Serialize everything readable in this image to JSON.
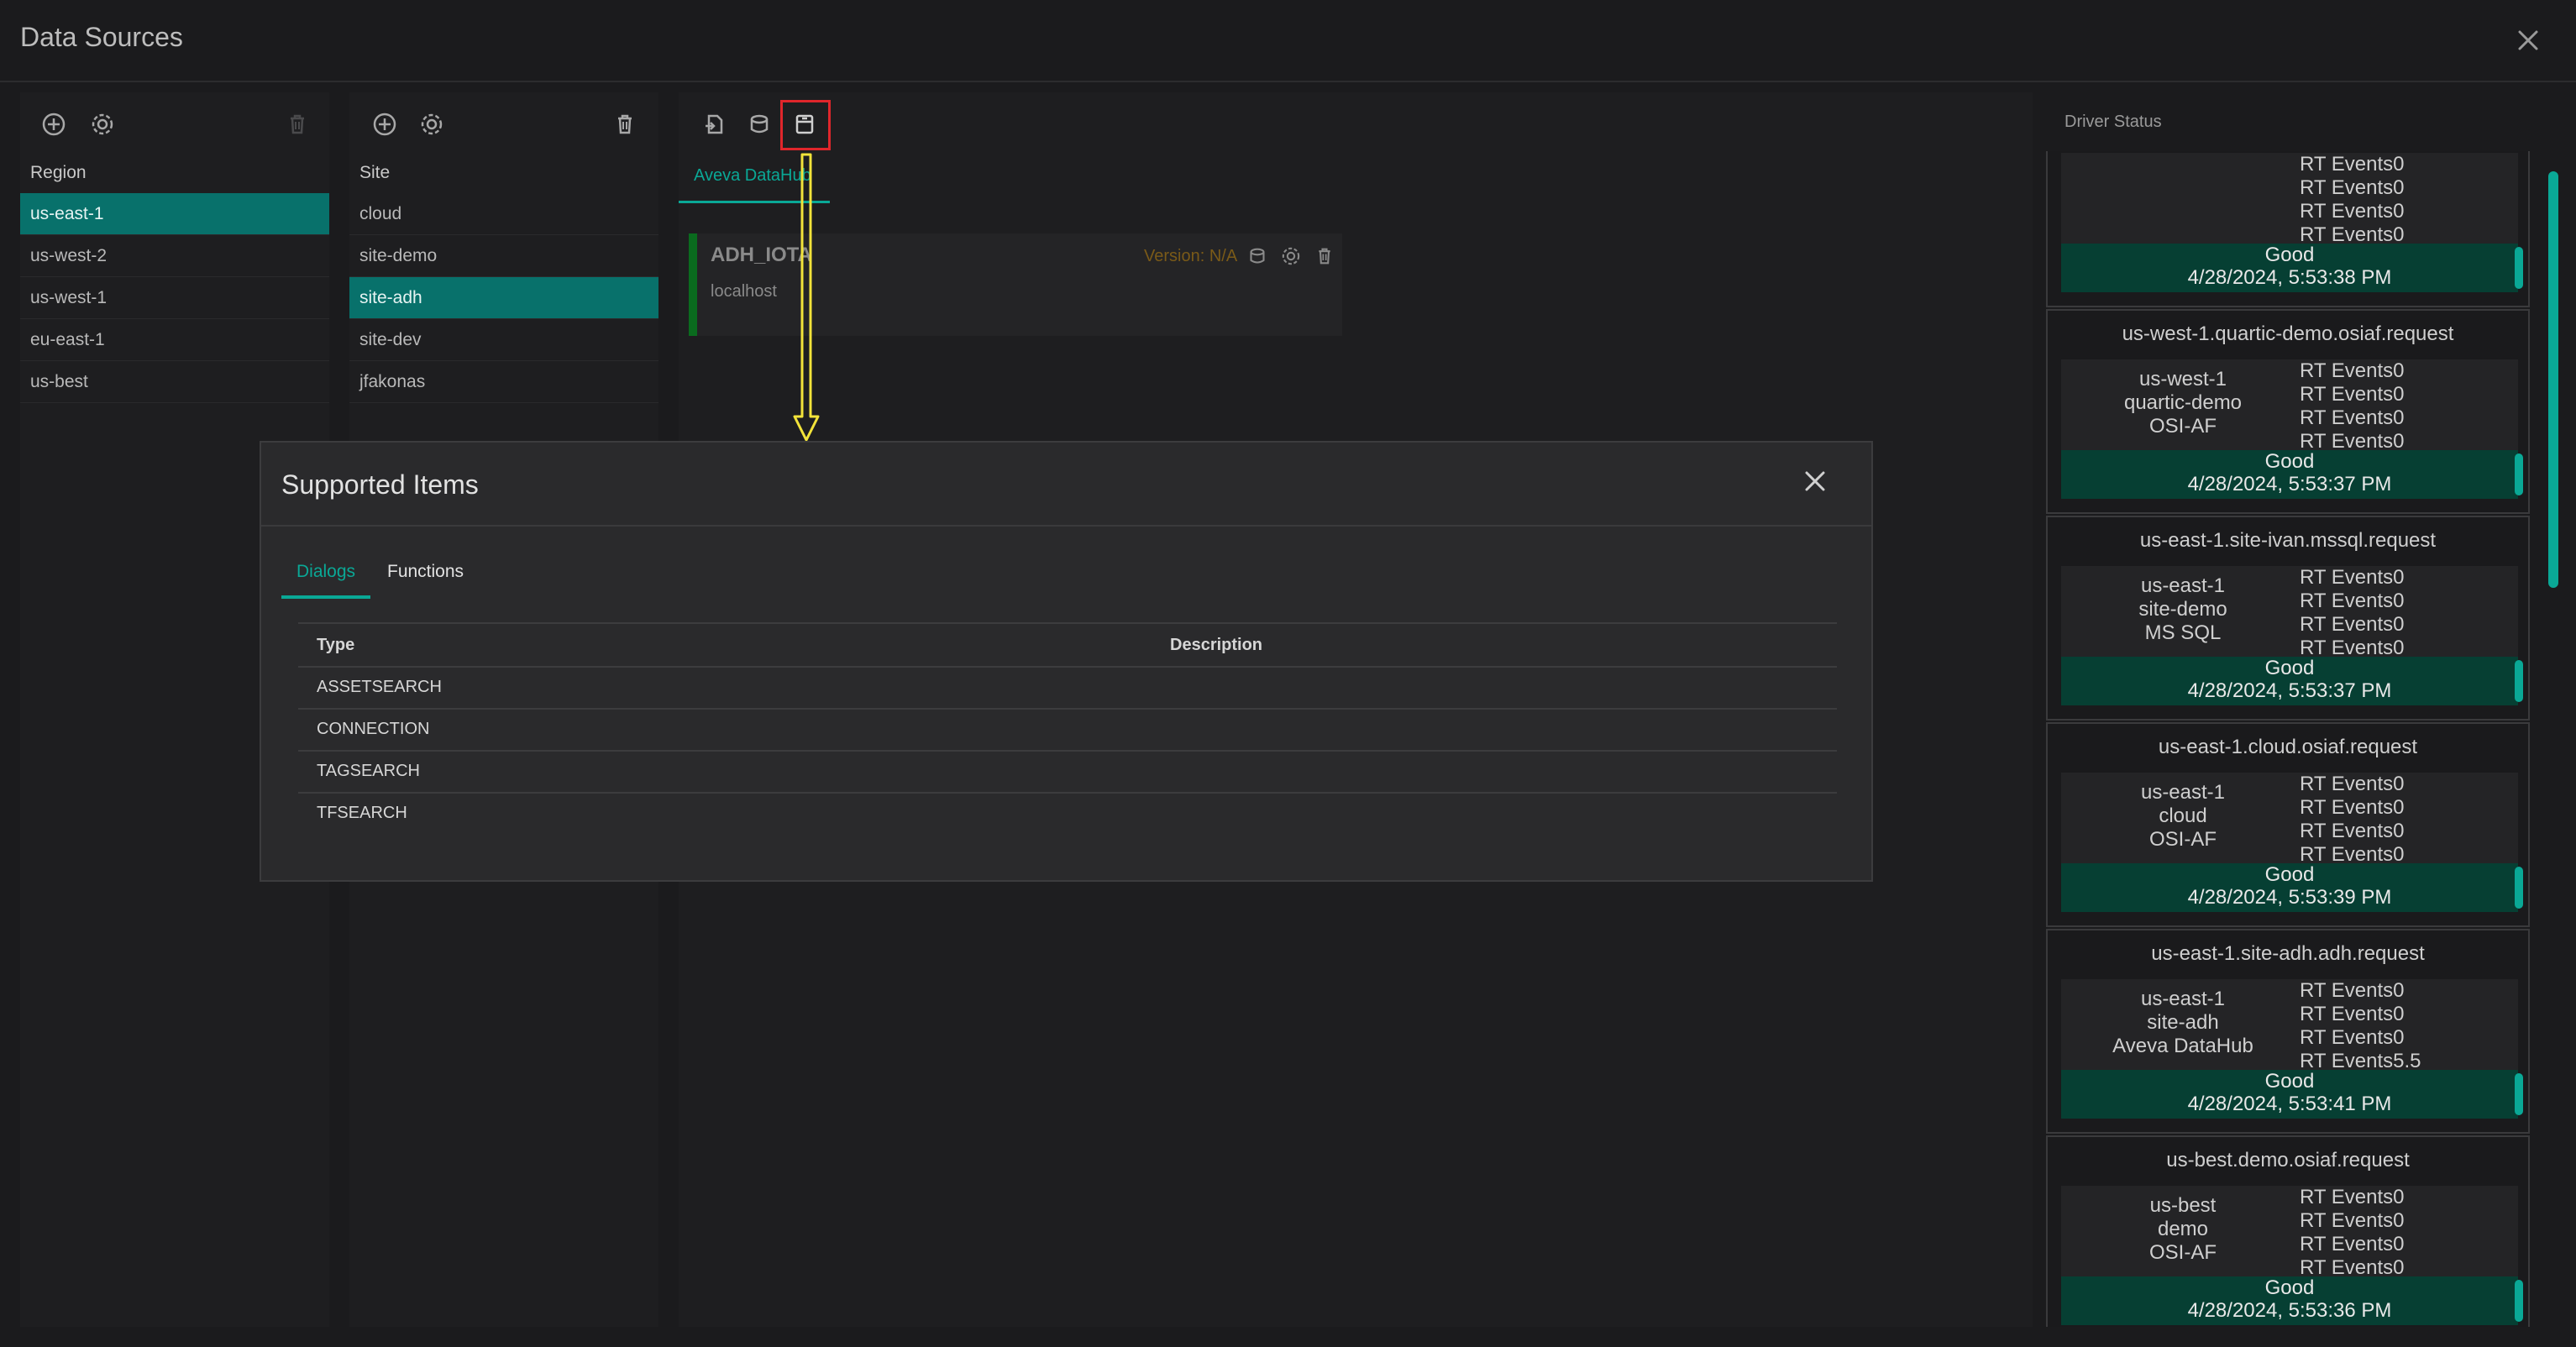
{
  "app": {
    "title": "Data Sources"
  },
  "region_panel": {
    "header": "Region",
    "items": [
      {
        "label": "us-east-1",
        "selected": true
      },
      {
        "label": "us-west-2",
        "selected": false
      },
      {
        "label": "us-west-1",
        "selected": false
      },
      {
        "label": "eu-east-1",
        "selected": false
      },
      {
        "label": "us-best",
        "selected": false
      }
    ]
  },
  "site_panel": {
    "header": "Site",
    "items": [
      {
        "label": "cloud",
        "selected": false
      },
      {
        "label": "site-demo",
        "selected": false
      },
      {
        "label": "site-adh",
        "selected": true
      },
      {
        "label": "site-dev",
        "selected": false
      },
      {
        "label": "jfakonas",
        "selected": false
      }
    ]
  },
  "driver_panel": {
    "tab": "Aveva DataHub",
    "card": {
      "name": "ADH_IOTA",
      "host": "localhost",
      "version": "Version: N/A"
    }
  },
  "driver_status": {
    "header": "Driver Status",
    "top_partial": {
      "events": [
        "RT Events0",
        "RT Events0",
        "RT Events0",
        "RT Events0"
      ],
      "status": "Good",
      "time": "4/28/2024, 5:53:38 PM"
    },
    "cards": [
      {
        "title": "us-west-1.quartic-demo.osiaf.request",
        "info": [
          "us-west-1",
          "quartic-demo",
          "OSI-AF"
        ],
        "events": [
          "RT Events0",
          "RT Events0",
          "RT Events0",
          "RT Events0"
        ],
        "status": "Good",
        "time": "4/28/2024, 5:53:37 PM"
      },
      {
        "title": "us-east-1.site-ivan.mssql.request",
        "info": [
          "us-east-1",
          "site-demo",
          "MS SQL"
        ],
        "events": [
          "RT Events0",
          "RT Events0",
          "RT Events0",
          "RT Events0"
        ],
        "status": "Good",
        "time": "4/28/2024, 5:53:37 PM"
      },
      {
        "title": "us-east-1.cloud.osiaf.request",
        "info": [
          "us-east-1",
          "cloud",
          "OSI-AF"
        ],
        "events": [
          "RT Events0",
          "RT Events0",
          "RT Events0",
          "RT Events0"
        ],
        "status": "Good",
        "time": "4/28/2024, 5:53:39 PM"
      },
      {
        "title": "us-east-1.site-adh.adh.request",
        "info": [
          "us-east-1",
          "site-adh",
          "Aveva DataHub"
        ],
        "events": [
          "RT Events0",
          "RT Events0",
          "RT Events0",
          "RT Events5.5"
        ],
        "status": "Good",
        "time": "4/28/2024, 5:53:41 PM"
      },
      {
        "title": "us-best.demo.osiaf.request",
        "info": [
          "us-best",
          "demo",
          "OSI-AF"
        ],
        "events": [
          "RT Events0",
          "RT Events0",
          "RT Events0",
          "RT Events0"
        ],
        "status": "Good",
        "time": "4/28/2024, 5:53:36 PM"
      }
    ]
  },
  "modal": {
    "title": "Supported Items",
    "tabs": [
      {
        "label": "Dialogs",
        "active": true
      },
      {
        "label": "Functions",
        "active": false
      }
    ],
    "columns": [
      "Type",
      "Description"
    ],
    "rows": [
      {
        "type": "ASSETSEARCH",
        "description": ""
      },
      {
        "type": "CONNECTION",
        "description": ""
      },
      {
        "type": "TAGSEARCH",
        "description": ""
      },
      {
        "type": "TFSEARCH",
        "description": ""
      }
    ]
  },
  "colors": {
    "accent": "#0aa896",
    "selected_row": "#08716b",
    "status_good_bg": "#063f33",
    "highlight_box": "#e0262b",
    "annotation_arrow": "#f2e33a",
    "version_text": "#7a5a18"
  },
  "icons": [
    "add-icon",
    "settings-icon",
    "delete-icon",
    "import-icon",
    "database-icon",
    "supported-items-icon",
    "close-icon"
  ]
}
